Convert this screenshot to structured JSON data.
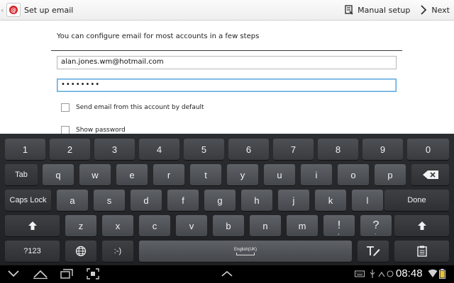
{
  "actionbar": {
    "title": "Set up email",
    "manual_setup_label": "Manual setup",
    "next_label": "Next"
  },
  "form": {
    "intro": "You can configure email for most accounts in a few steps",
    "email_value": "alan.jones.wm@hotmail.com",
    "password_value": "••••••••",
    "default_checkbox_label": "Send email from this account by default",
    "show_password_label": "Show password",
    "default_checked": false,
    "show_password_checked": false
  },
  "keyboard": {
    "language": "English(UK)",
    "numbers": [
      "1",
      "2",
      "3",
      "4",
      "5",
      "6",
      "7",
      "8",
      "9",
      "0"
    ],
    "row1": [
      "q",
      "w",
      "e",
      "r",
      "t",
      "y",
      "u",
      "i",
      "o",
      "p"
    ],
    "row2": [
      "a",
      "s",
      "d",
      "f",
      "g",
      "h",
      "j",
      "k",
      "l"
    ],
    "row3": [
      "z",
      "x",
      "c",
      "v",
      "b",
      "n",
      "m",
      "!",
      "?"
    ],
    "tab_label": "Tab",
    "caps_label": "Caps Lock",
    "done_label": "Done",
    "symbols_label": "?123",
    "emoticon_label": ":-)",
    "punct_sub": [
      ",",
      "."
    ]
  },
  "status": {
    "time": "08:48"
  },
  "colors": {
    "accent_focus": "#5aa6dc",
    "app_icon": "#d2232a"
  },
  "icons": {
    "app": "email-app-icon",
    "manual": "manual-setup-icon",
    "next": "chevron-right-icon",
    "backspace": "backspace-icon",
    "shift": "shift-arrow-icon",
    "globe": "globe-icon",
    "handwriting": "handwriting-icon",
    "clipboard": "clipboard-icon"
  }
}
